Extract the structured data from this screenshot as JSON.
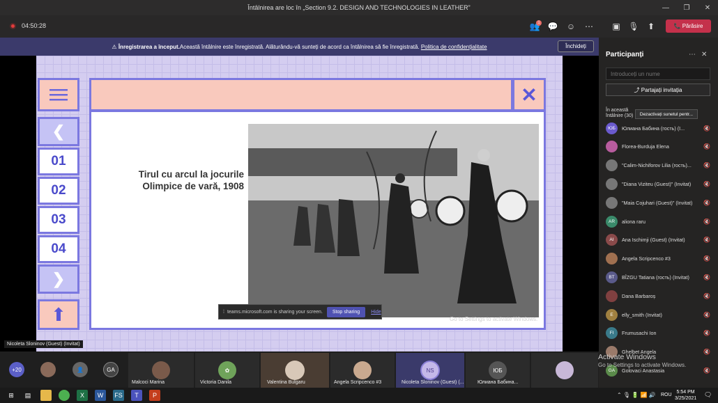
{
  "window": {
    "title": "Întâlnirea are loc în „Section 9.2. DESIGN AND TECHNOLOGIES IN LEATHER”"
  },
  "meeting": {
    "timer": "04:50:28",
    "leave_label": "Părăsire",
    "participant_count_badge": "1"
  },
  "banner": {
    "bold": "Înregistrarea a început.",
    "text": " Această întâlnire este înregistrată. Alăturându-vă sunteți de acord ca întâlnirea să fie înregistrată.",
    "link": "Politica de confidențialitate",
    "close_label": "Închideți"
  },
  "slide": {
    "title": "Tirul cu arcul la jocurile Olimpice de vară, 1908",
    "nav": [
      "01",
      "02",
      "03",
      "04"
    ],
    "menu_icon": "menu-icon",
    "prev_icon": "chevron-left-icon",
    "next_icon": "chevron-right-icon",
    "up_icon": "arrow-up-icon",
    "close_icon": "close-icon"
  },
  "share": {
    "text": "teams.microsoft.com is sharing your screen.",
    "stop": "Stop sharing",
    "hide": "Hide"
  },
  "watermark": {
    "line1": "Activate Windows",
    "line2": "Go to Settings to activate Windows.",
    "slide_text": "Go to Settings to activate Windows."
  },
  "presenter": "Nicoleta Sloninov (Guest) (Invitat)",
  "gallery": {
    "more": "+20",
    "ga": "GA",
    "ns": "NS",
    "yb": "ЮБ",
    "names": [
      "Malcoci Marina",
      "Victoria Danila",
      "Valentina Bulgaru",
      "Angela Scripcenco #3",
      "Nicoleta Sloninov (Guest) (...",
      "Юлиана Бабина..."
    ]
  },
  "panel": {
    "title": "Participanți",
    "search_placeholder": "Introduceți un nume",
    "invite": "Partajați invitația",
    "in_meeting": "În această întâlnire (30)",
    "mute_all": "Dezactivați sunetul pentr..."
  },
  "participants": [
    {
      "initials": "ЮБ",
      "name": "Юлиана Бабина (гость) (I..."
    },
    {
      "initials": "",
      "name": "Florea-Burduja Elena"
    },
    {
      "initials": "",
      "name": "\"Calim-Nichiforov Lilia (гость)..."
    },
    {
      "initials": "",
      "name": "\"Diana Viziteu (Guest)\" (Invitat)"
    },
    {
      "initials": "",
      "name": "\"Maia Cojuhari (Guest)\" (Invitat)"
    },
    {
      "initials": "AR",
      "name": "aliona raru"
    },
    {
      "initials": "AI",
      "name": "Ana Ischimji (Guest) (Invitat)"
    },
    {
      "initials": "",
      "name": "Angela Scripcenco #3"
    },
    {
      "initials": "BT",
      "name": "BÎZGU Tatiana (гость) (Invitat)"
    },
    {
      "initials": "",
      "name": "Dana Barbaroș"
    },
    {
      "initials": "E",
      "name": "elly_smith (Invitat)"
    },
    {
      "initials": "FI",
      "name": "Frumusachi Ion"
    },
    {
      "initials": "",
      "name": "Ghelbet Angela"
    },
    {
      "initials": "GA",
      "name": "Golovaci Anastasia"
    }
  ],
  "taskbar": {
    "time": "5:54 PM",
    "date": "3/25/2021",
    "lang": "ROU"
  }
}
